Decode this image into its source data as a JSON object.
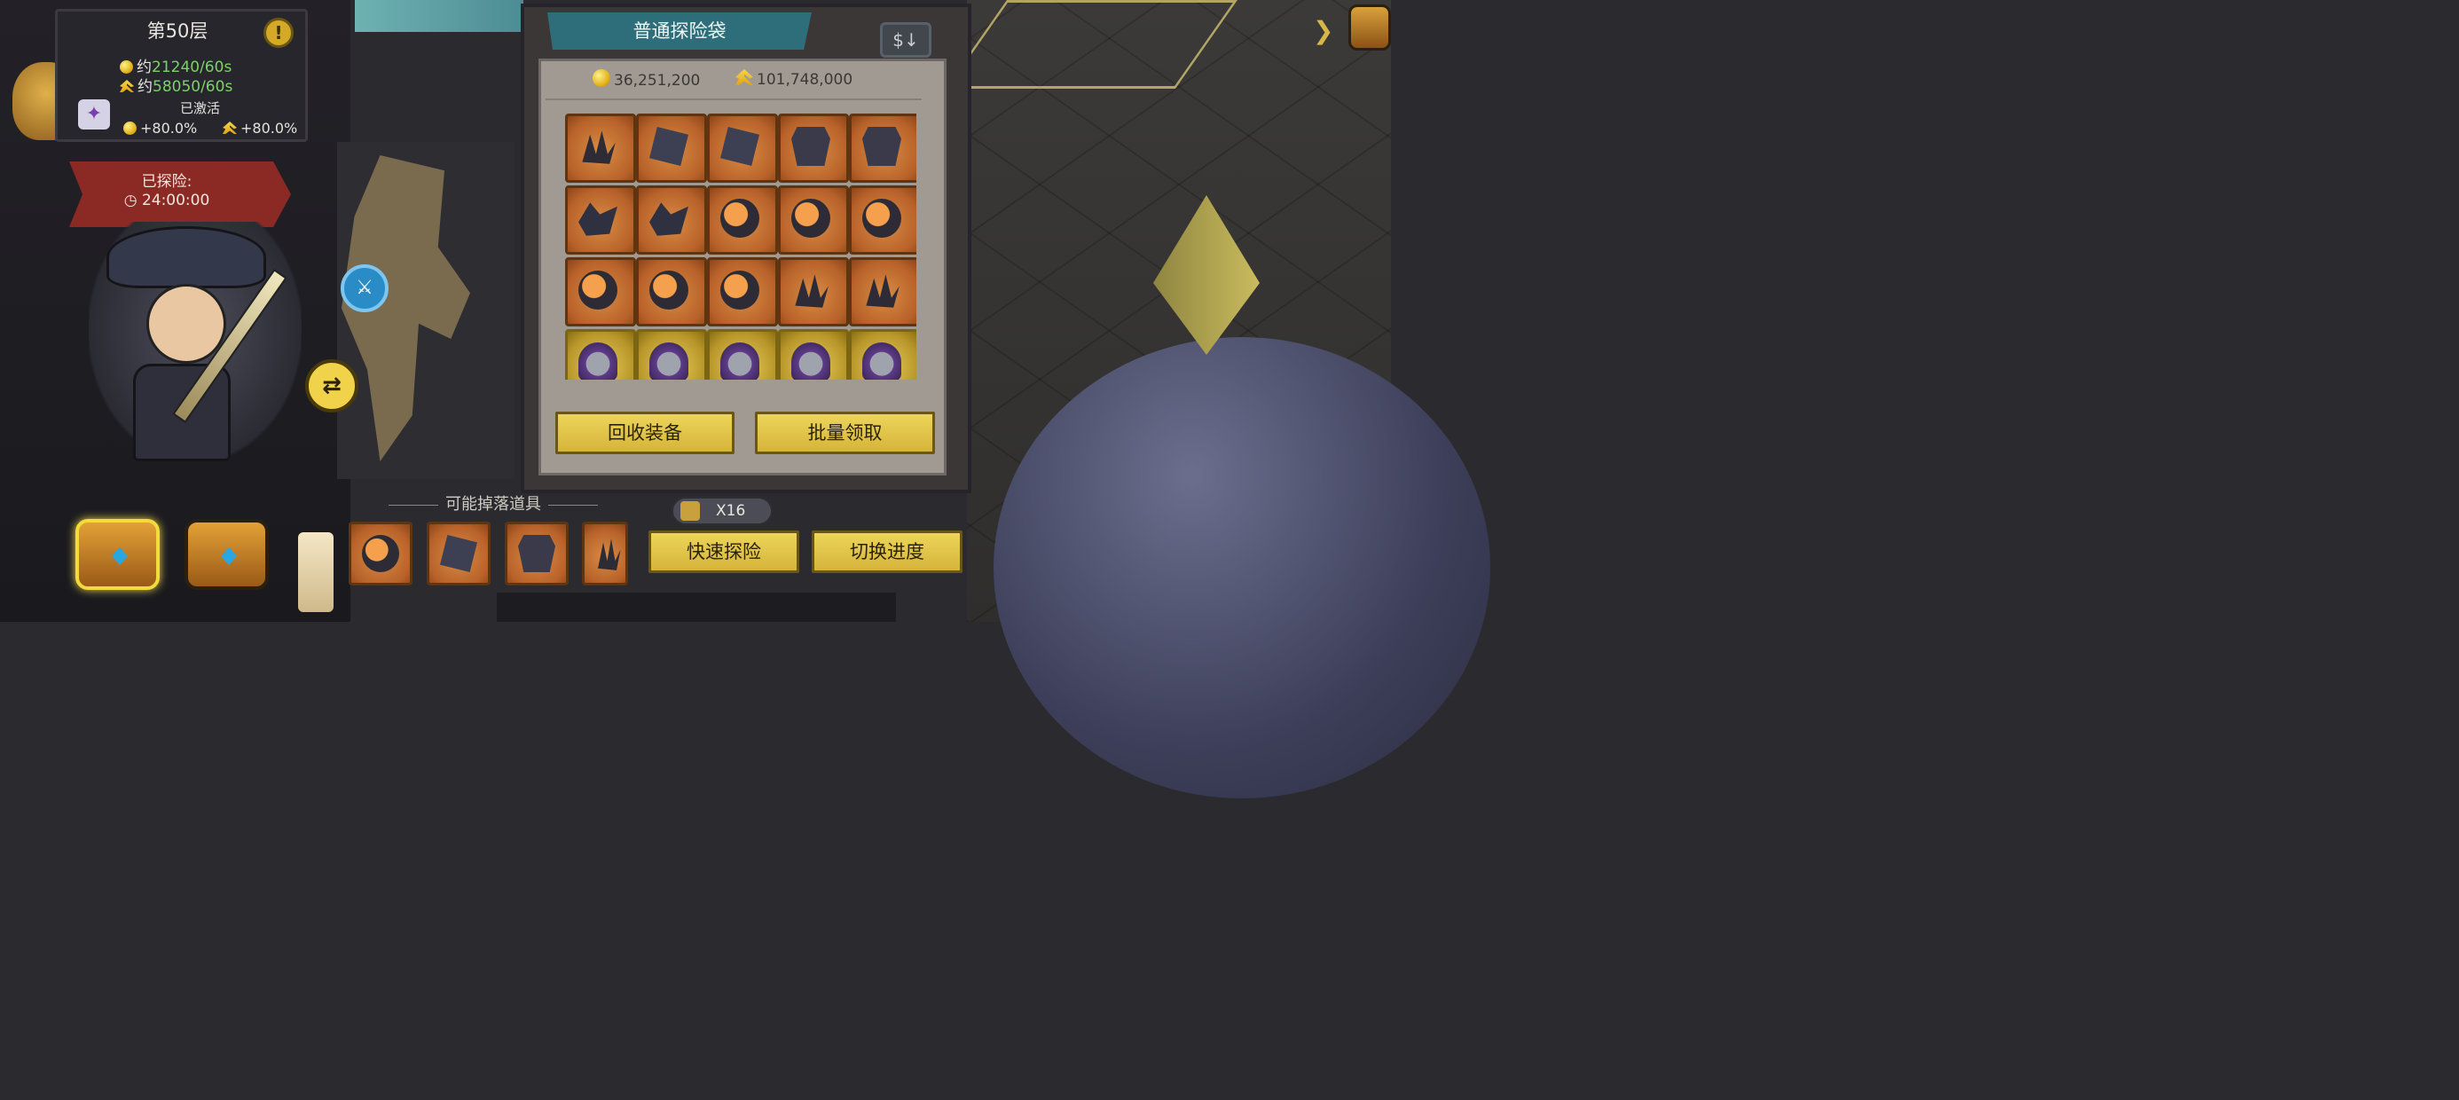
{
  "floor": {
    "title": "第50层",
    "gold_rate_prefix": "约",
    "gold_rate": "21240/60s",
    "exp_rate_prefix": "约",
    "exp_rate": "58050/60s"
  },
  "bonus": {
    "status": "已激活",
    "gold_bonus": "+80.0%",
    "exp_bonus": "+80.0%"
  },
  "explore": {
    "label": "已探险:",
    "time": "24:00:00"
  },
  "bag": {
    "title": "普通探险袋",
    "gold_amount": "36,251,200",
    "exp_amount": "101,748,000",
    "items": [
      "claw",
      "chain",
      "chain",
      "armor",
      "armor",
      "beast",
      "beast",
      "orb",
      "orb",
      "orb",
      "orb",
      "orb",
      "orb",
      "claw",
      "claw",
      "skull",
      "skull",
      "skull",
      "skull",
      "skull"
    ],
    "recycle_label": "回收装备",
    "batch_claim_label": "批量领取"
  },
  "drops": {
    "label": "可能掉落道具",
    "items": [
      "orb",
      "chain",
      "armor",
      "claw"
    ]
  },
  "ticket": {
    "count": "X16"
  },
  "actions": {
    "quick_explore_label": "快速探险",
    "switch_progress_label": "切换进度"
  },
  "icons": {
    "alert": "!",
    "sort": "$↓",
    "swap": "⇄",
    "map_marker": "⚔",
    "arrow": "❯"
  }
}
